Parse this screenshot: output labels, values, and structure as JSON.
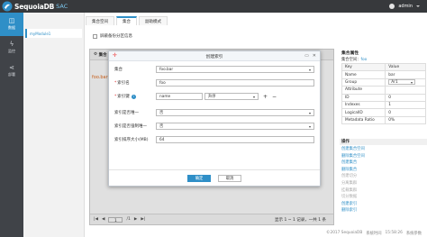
{
  "app": {
    "name": "SequoiaDB",
    "product": "SAC",
    "user": "admin"
  },
  "rail": [
    {
      "label": "数据",
      "icon": "database-icon",
      "active": true
    },
    {
      "label": "监控",
      "icon": "lightning-icon",
      "active": false
    },
    {
      "label": "部署",
      "icon": "share-icon",
      "active": false
    }
  ],
  "module": {
    "name": "myModule1"
  },
  "tabs": [
    "集合空间",
    "集合",
    "副助模式"
  ],
  "options": {
    "show_partition_info": "屏蔽备份分区信息"
  },
  "panel": {
    "header": "集合",
    "link": "foo.bar",
    "pager": {
      "first": "|◀",
      "prev": "◀",
      "page": "1",
      "total": "/1",
      "next": "▶",
      "last": "▶|",
      "info": "显示 1 ~ 1 记录，一共 1 条"
    }
  },
  "dialog": {
    "title": "创建索引",
    "collection_label": "集合",
    "collection_value": "foo.bar",
    "index_name_label": "索引名",
    "index_name_value": "foo",
    "index_key_label": "索引键",
    "index_key_field": "name",
    "index_key_order": "升序",
    "unique_label": "索引是否唯一",
    "unique_value": "否",
    "enforced_label": "索引是否强制唯一",
    "enforced_value": "否",
    "sort_buffer_label": "索引排序大小(MB)",
    "sort_buffer_value": "64",
    "ok": "确定",
    "cancel": "取消"
  },
  "sidebar": {
    "title": "集合属性",
    "subtitle_prefix": "集合空间：",
    "subtitle_value": "foo",
    "columns": [
      "Key",
      "Value"
    ],
    "rows": [
      {
        "key": "Name",
        "value": "bar"
      },
      {
        "key": "Group",
        "value": "Ar1"
      },
      {
        "key": "Attribute",
        "value": ""
      },
      {
        "key": "ID",
        "value": "0"
      },
      {
        "key": "Indexes",
        "value": "1"
      },
      {
        "key": "LogicalID",
        "value": "0"
      },
      {
        "key": "Metadata Ratio",
        "value": "0%"
      }
    ],
    "ops_title": "操作",
    "ops": [
      {
        "label": "创建集合空间",
        "enabled": true
      },
      {
        "label": "删除集合空间",
        "enabled": true
      },
      {
        "label": "创建集合",
        "enabled": true
      },
      {
        "label": "删除集合",
        "enabled": true
      },
      {
        "label": "创建切分",
        "enabled": false
      },
      {
        "label": "分离集群",
        "enabled": false
      },
      {
        "label": "挂载集群",
        "enabled": false
      },
      {
        "label": "切分数据",
        "enabled": false
      },
      {
        "label": "创建索引",
        "enabled": true
      },
      {
        "label": "删除索引",
        "enabled": true
      }
    ]
  },
  "footer": {
    "copyright": "©2017 SequoiaDB",
    "time_label": "系统时间",
    "time_value": "15:58:26",
    "lang": "系统参数"
  }
}
